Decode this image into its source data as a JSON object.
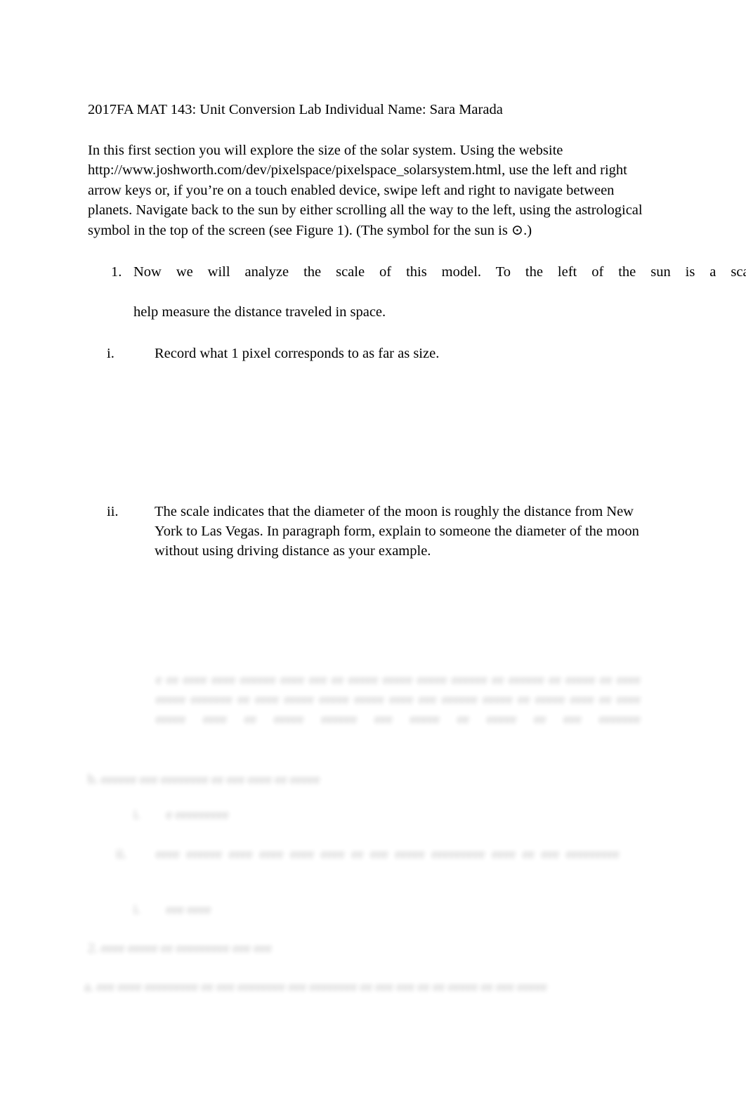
{
  "document": {
    "header": "2017FA MAT 143: Unit Conversion Lab Individual Name: Sara Marada",
    "intro_paragraph": "In this first section you will explore the size of the solar system. Using the website http://www.joshworth.com/dev/pixelspace/pixelspace_solarsystem.html, use the left and right arrow keys or, if you’re on a touch enabled device, swipe left and right to navigate between planets. Navigate back to the sun by either scrolling all the way to the left, using the astrological symbol in the top of the screen (see Figure 1). (The symbol for the sun is ⊙.)",
    "sun_symbol": "⊙",
    "items": [
      {
        "marker": "1.",
        "level": 1,
        "text_line_1": "Now we will analyze the scale of this model. To the left of the sun is a scale t",
        "text_line_2": "help measure the distance traveled in space.",
        "clipped_at_right_edge": true
      },
      {
        "marker": "i.",
        "level": 2,
        "text": "Record what 1 pixel corresponds to as far as size."
      },
      {
        "marker": "ii.",
        "level": 2,
        "text": "The scale indicates that the diameter of the moon is roughly the distance from New York to Las Vegas. In paragraph form, explain to someone the diameter of the moon without using driving distance as your example."
      }
    ],
    "faded_section": {
      "note_visible_but_illegible": true,
      "answer_paragraph": "e ee eeee eeee eeeeee eeee eee ee eeeee eeeee eeeee eeeeee ee eeeeee ee eeeee ee eeee eeeee eeeeeee ee eeee eeeee eeeee eeeee eeee eee eeeeee eeeee ee eeeee eeee ee eeee eeeee eeee ee eeeee eeeeee eee eeeee ee eeeee ee eee eeeeeee",
      "rows": [
        {
          "marker": "b.",
          "text": "eeeeee eee eeeeeeee ee eee eeee ee eeeee"
        },
        {
          "marker": "i.",
          "text": "e eeeeeeeee"
        },
        {
          "marker": "ii.",
          "text": "eeee eeeeee eeee eeee eeee eeee ee eee eeeee eeeeeeeee eeee ee eee eeeeeeeee"
        },
        {
          "marker": "i.",
          "text": "eee eeee"
        },
        {
          "marker": "2.",
          "text": "eeee eeeee ee eeeeeeeee eee eee"
        },
        {
          "marker": "a.",
          "text": "eee eeee eeeeeeeee ee eee eeeeeeee eee eeeeeeee ee eee eee ee ee eeeee ee eee eeeee"
        }
      ]
    }
  }
}
